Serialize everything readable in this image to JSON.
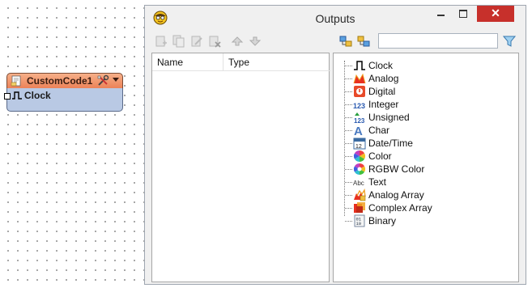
{
  "component": {
    "title": "CustomCode1",
    "output_label": "Clock",
    "header_color": "#ec8258",
    "body_color": "#b9c9e4"
  },
  "window": {
    "title": "Outputs",
    "close_glyph": "✕",
    "close_color": "#c7302b"
  },
  "toolbar": {
    "left_buttons": [
      "add-output-icon",
      "duplicate-output-icon",
      "edit-output-icon",
      "delete-output-icon",
      "move-up-icon",
      "move-down-icon"
    ],
    "right_buttons": [
      "expand-all-icon",
      "collapse-all-icon",
      "filter-icon"
    ],
    "search_value": ""
  },
  "table": {
    "columns": [
      "Name",
      "Type"
    ],
    "rows": []
  },
  "types": [
    {
      "label": "Clock",
      "icon": "clock-signal-icon"
    },
    {
      "label": "Analog",
      "icon": "analog-icon"
    },
    {
      "label": "Digital",
      "icon": "digital-icon"
    },
    {
      "label": "Integer",
      "icon": "integer-icon"
    },
    {
      "label": "Unsigned",
      "icon": "unsigned-icon"
    },
    {
      "label": "Char",
      "icon": "char-icon"
    },
    {
      "label": "Date/Time",
      "icon": "calendar-icon"
    },
    {
      "label": "Color",
      "icon": "color-wheel-icon"
    },
    {
      "label": "RGBW Color",
      "icon": "rgbw-color-icon"
    },
    {
      "label": "Text",
      "icon": "text-icon"
    },
    {
      "label": "Analog Array",
      "icon": "analog-array-icon"
    },
    {
      "label": "Complex Array",
      "icon": "complex-array-icon"
    },
    {
      "label": "Binary",
      "icon": "binary-icon"
    }
  ]
}
